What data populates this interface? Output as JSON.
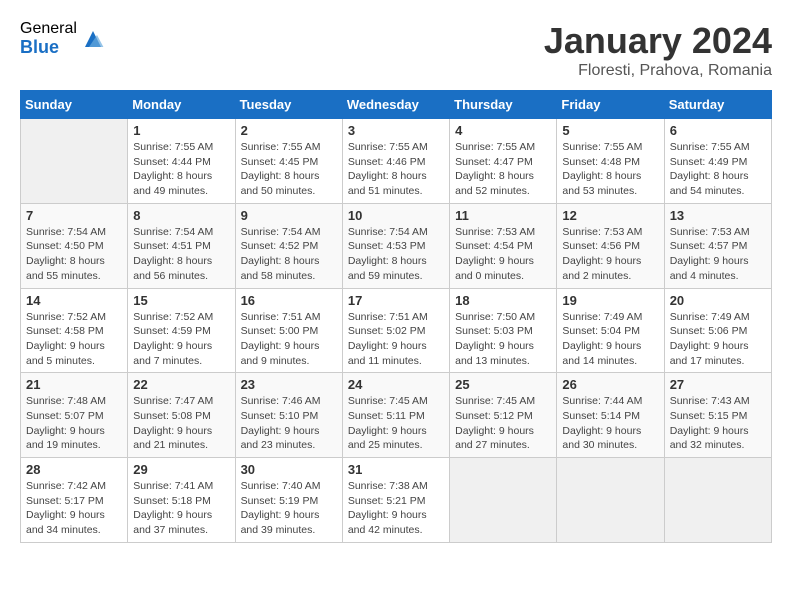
{
  "logo": {
    "general": "General",
    "blue": "Blue"
  },
  "title": "January 2024",
  "subtitle": "Floresti, Prahova, Romania",
  "weekdays": [
    "Sunday",
    "Monday",
    "Tuesday",
    "Wednesday",
    "Thursday",
    "Friday",
    "Saturday"
  ],
  "weeks": [
    [
      {
        "day": "",
        "info": ""
      },
      {
        "day": "1",
        "info": "Sunrise: 7:55 AM\nSunset: 4:44 PM\nDaylight: 8 hours\nand 49 minutes."
      },
      {
        "day": "2",
        "info": "Sunrise: 7:55 AM\nSunset: 4:45 PM\nDaylight: 8 hours\nand 50 minutes."
      },
      {
        "day": "3",
        "info": "Sunrise: 7:55 AM\nSunset: 4:46 PM\nDaylight: 8 hours\nand 51 minutes."
      },
      {
        "day": "4",
        "info": "Sunrise: 7:55 AM\nSunset: 4:47 PM\nDaylight: 8 hours\nand 52 minutes."
      },
      {
        "day": "5",
        "info": "Sunrise: 7:55 AM\nSunset: 4:48 PM\nDaylight: 8 hours\nand 53 minutes."
      },
      {
        "day": "6",
        "info": "Sunrise: 7:55 AM\nSunset: 4:49 PM\nDaylight: 8 hours\nand 54 minutes."
      }
    ],
    [
      {
        "day": "7",
        "info": "Sunrise: 7:54 AM\nSunset: 4:50 PM\nDaylight: 8 hours\nand 55 minutes."
      },
      {
        "day": "8",
        "info": "Sunrise: 7:54 AM\nSunset: 4:51 PM\nDaylight: 8 hours\nand 56 minutes."
      },
      {
        "day": "9",
        "info": "Sunrise: 7:54 AM\nSunset: 4:52 PM\nDaylight: 8 hours\nand 58 minutes."
      },
      {
        "day": "10",
        "info": "Sunrise: 7:54 AM\nSunset: 4:53 PM\nDaylight: 8 hours\nand 59 minutes."
      },
      {
        "day": "11",
        "info": "Sunrise: 7:53 AM\nSunset: 4:54 PM\nDaylight: 9 hours\nand 0 minutes."
      },
      {
        "day": "12",
        "info": "Sunrise: 7:53 AM\nSunset: 4:56 PM\nDaylight: 9 hours\nand 2 minutes."
      },
      {
        "day": "13",
        "info": "Sunrise: 7:53 AM\nSunset: 4:57 PM\nDaylight: 9 hours\nand 4 minutes."
      }
    ],
    [
      {
        "day": "14",
        "info": "Sunrise: 7:52 AM\nSunset: 4:58 PM\nDaylight: 9 hours\nand 5 minutes."
      },
      {
        "day": "15",
        "info": "Sunrise: 7:52 AM\nSunset: 4:59 PM\nDaylight: 9 hours\nand 7 minutes."
      },
      {
        "day": "16",
        "info": "Sunrise: 7:51 AM\nSunset: 5:00 PM\nDaylight: 9 hours\nand 9 minutes."
      },
      {
        "day": "17",
        "info": "Sunrise: 7:51 AM\nSunset: 5:02 PM\nDaylight: 9 hours\nand 11 minutes."
      },
      {
        "day": "18",
        "info": "Sunrise: 7:50 AM\nSunset: 5:03 PM\nDaylight: 9 hours\nand 13 minutes."
      },
      {
        "day": "19",
        "info": "Sunrise: 7:49 AM\nSunset: 5:04 PM\nDaylight: 9 hours\nand 14 minutes."
      },
      {
        "day": "20",
        "info": "Sunrise: 7:49 AM\nSunset: 5:06 PM\nDaylight: 9 hours\nand 17 minutes."
      }
    ],
    [
      {
        "day": "21",
        "info": "Sunrise: 7:48 AM\nSunset: 5:07 PM\nDaylight: 9 hours\nand 19 minutes."
      },
      {
        "day": "22",
        "info": "Sunrise: 7:47 AM\nSunset: 5:08 PM\nDaylight: 9 hours\nand 21 minutes."
      },
      {
        "day": "23",
        "info": "Sunrise: 7:46 AM\nSunset: 5:10 PM\nDaylight: 9 hours\nand 23 minutes."
      },
      {
        "day": "24",
        "info": "Sunrise: 7:45 AM\nSunset: 5:11 PM\nDaylight: 9 hours\nand 25 minutes."
      },
      {
        "day": "25",
        "info": "Sunrise: 7:45 AM\nSunset: 5:12 PM\nDaylight: 9 hours\nand 27 minutes."
      },
      {
        "day": "26",
        "info": "Sunrise: 7:44 AM\nSunset: 5:14 PM\nDaylight: 9 hours\nand 30 minutes."
      },
      {
        "day": "27",
        "info": "Sunrise: 7:43 AM\nSunset: 5:15 PM\nDaylight: 9 hours\nand 32 minutes."
      }
    ],
    [
      {
        "day": "28",
        "info": "Sunrise: 7:42 AM\nSunset: 5:17 PM\nDaylight: 9 hours\nand 34 minutes."
      },
      {
        "day": "29",
        "info": "Sunrise: 7:41 AM\nSunset: 5:18 PM\nDaylight: 9 hours\nand 37 minutes."
      },
      {
        "day": "30",
        "info": "Sunrise: 7:40 AM\nSunset: 5:19 PM\nDaylight: 9 hours\nand 39 minutes."
      },
      {
        "day": "31",
        "info": "Sunrise: 7:38 AM\nSunset: 5:21 PM\nDaylight: 9 hours\nand 42 minutes."
      },
      {
        "day": "",
        "info": ""
      },
      {
        "day": "",
        "info": ""
      },
      {
        "day": "",
        "info": ""
      }
    ]
  ]
}
